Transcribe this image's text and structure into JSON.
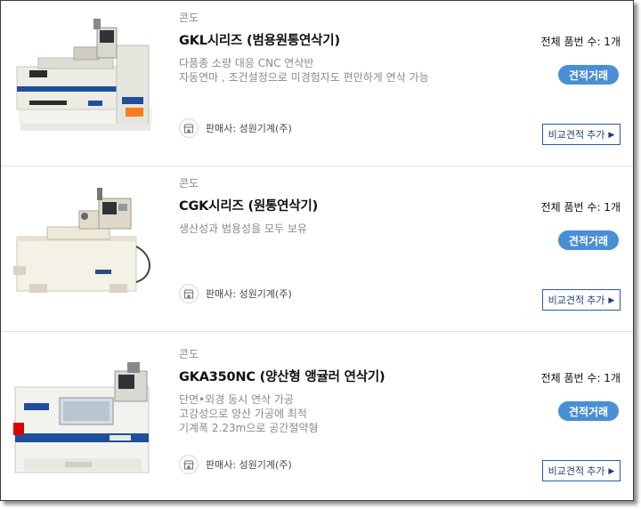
{
  "products": [
    {
      "brand": "콘도",
      "title": "GKL시리즈 (범용원통연삭기)",
      "description": [
        "다품종 소량 대응 CNC 연삭반",
        "자동연마 , 조건설정으로 미경험자도 편안하게 연삭 가능"
      ],
      "seller": "판매사: 성원기계(주)",
      "count": "전체 품번 수: 1개",
      "quote_label": "견적거래",
      "compare_label": "비교견적 추가",
      "image_icon": "grinding-machine-image"
    },
    {
      "brand": "콘도",
      "title": "CGK시리즈 (원통연삭기)",
      "description": [
        "생산성과 범용성을 모두 보유"
      ],
      "seller": "판매사: 성원기계(주)",
      "count": "전체 품번 수: 1개",
      "quote_label": "견적거래",
      "compare_label": "비교견적 추가",
      "image_icon": "grinding-machine-image"
    },
    {
      "brand": "콘도",
      "title": "GKA350NC (양산형 앵귤러 연삭기)",
      "description": [
        "단면•외경 동시 연삭 가공",
        "고강성으로 양산 가공에 최적",
        "기계폭 2.23m으로 공간절약형"
      ],
      "seller": "판매사: 성원기계(주)",
      "count": "전체 품번 수: 1개",
      "quote_label": "견적거래",
      "compare_label": "비교견적 추가",
      "image_icon": "grinding-machine-image"
    }
  ],
  "colors": {
    "accent": "#4a8ed6",
    "compare_border": "#2b5aa8",
    "machine_stripe": "#1f4f9c"
  }
}
